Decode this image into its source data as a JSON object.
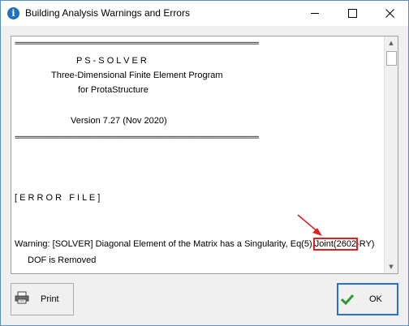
{
  "window": {
    "title": "Building Analysis Warnings and Errors",
    "app_icon_glyph": "i"
  },
  "log": {
    "separator": "====================================================================",
    "program_name": "P S - S O L V E R",
    "program_desc": "Three-Dimensional Finite Element Program",
    "program_for": "for ProtaStructure",
    "version": "Version 7.27 (Nov 2020)",
    "section_header": "[ E R R O R   F I L E ]",
    "warning_prefix": "Warning: [SOLVER] Diagonal Element of the Matrix has a Singularity, Eq(5),",
    "warning_joint": "Joint(2602",
    "warning_suffix": "-RY)",
    "warning_line2": "DOF is Removed"
  },
  "buttons": {
    "print_label": "Print",
    "ok_label": "OK"
  },
  "colors": {
    "highlight": "#e02020",
    "accent": "#2a6fd3",
    "check": "#2e9a2e"
  }
}
